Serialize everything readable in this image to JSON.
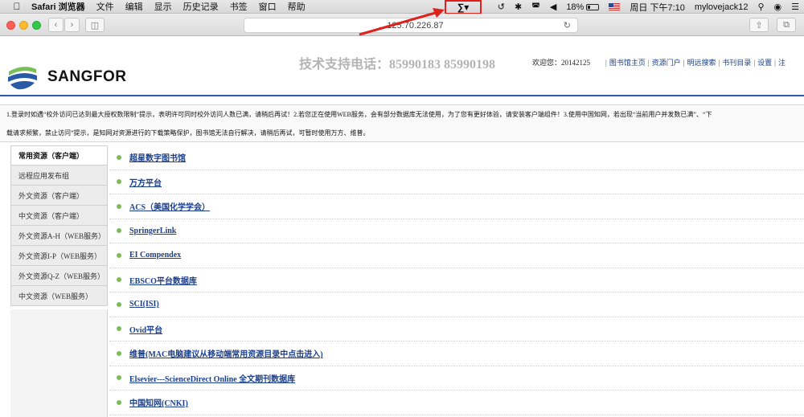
{
  "menubar": {
    "apple": "",
    "items": [
      "Safari 浏览器",
      "文件",
      "编辑",
      "显示",
      "历史记录",
      "书签",
      "窗口",
      "帮助"
    ],
    "right": {
      "battery": "18%",
      "datetime": "周日 下午7:10",
      "user": "mylovejack12"
    }
  },
  "toolbar": {
    "url": "…125.70.226.87"
  },
  "header": {
    "logo_text": "SANGFOR",
    "hotline": "技术支持电话：85990183  85990198",
    "welcome": "欢迎您：20142125",
    "links": [
      "图书馆主页",
      "资源门户",
      "明远搜索",
      "书刊目录",
      "设置",
      "注"
    ]
  },
  "notice": {
    "line1": "1.登录时如遇“校外访问已达到最大授权数限制”提示，表明许可同时校外访问人数已满，请稍后再试！2.若您正在使用WEB服务，会有部分数据库无法使用，为了您有更好体验，请安装客户端组件！3.使用中国知网，若出现“当前用户并发数已满”、“下",
    "line2": "载请求频繁，禁止访问”提示，是知网对资源进行的下载策略保护，图书馆无法自行解决，请稍后再试，可暂时使用万方、维普。"
  },
  "sidebar": {
    "items": [
      "常用资源（客户端）",
      "远程应用发布组",
      "外文资源（客户端）",
      "中文资源（客户端）",
      "外文资源A-H（WEB服务）",
      "外文资源I-P（WEB服务）",
      "外文资源Q-Z（WEB服务）",
      "中文资源（WEB服务）"
    ]
  },
  "resources": [
    "超星数字图书馆",
    "万方平台",
    "ACS（美国化学学会）",
    "SpringerLink",
    "EI Compendex",
    "EBSCO平台数据库",
    "SCI(ISI)",
    "Ovid平台",
    "维普(MAC电脑建议从移动端常用资源目录中点击进入)",
    "Elsevier---ScienceDirect Online 全文期刊数据库",
    "中国知网(CNKI)"
  ],
  "colors": {
    "link": "#1b3f8a",
    "header_rule": "#2a5aa6",
    "bullet": "#7bbd59",
    "annotation": "#e0201b"
  }
}
